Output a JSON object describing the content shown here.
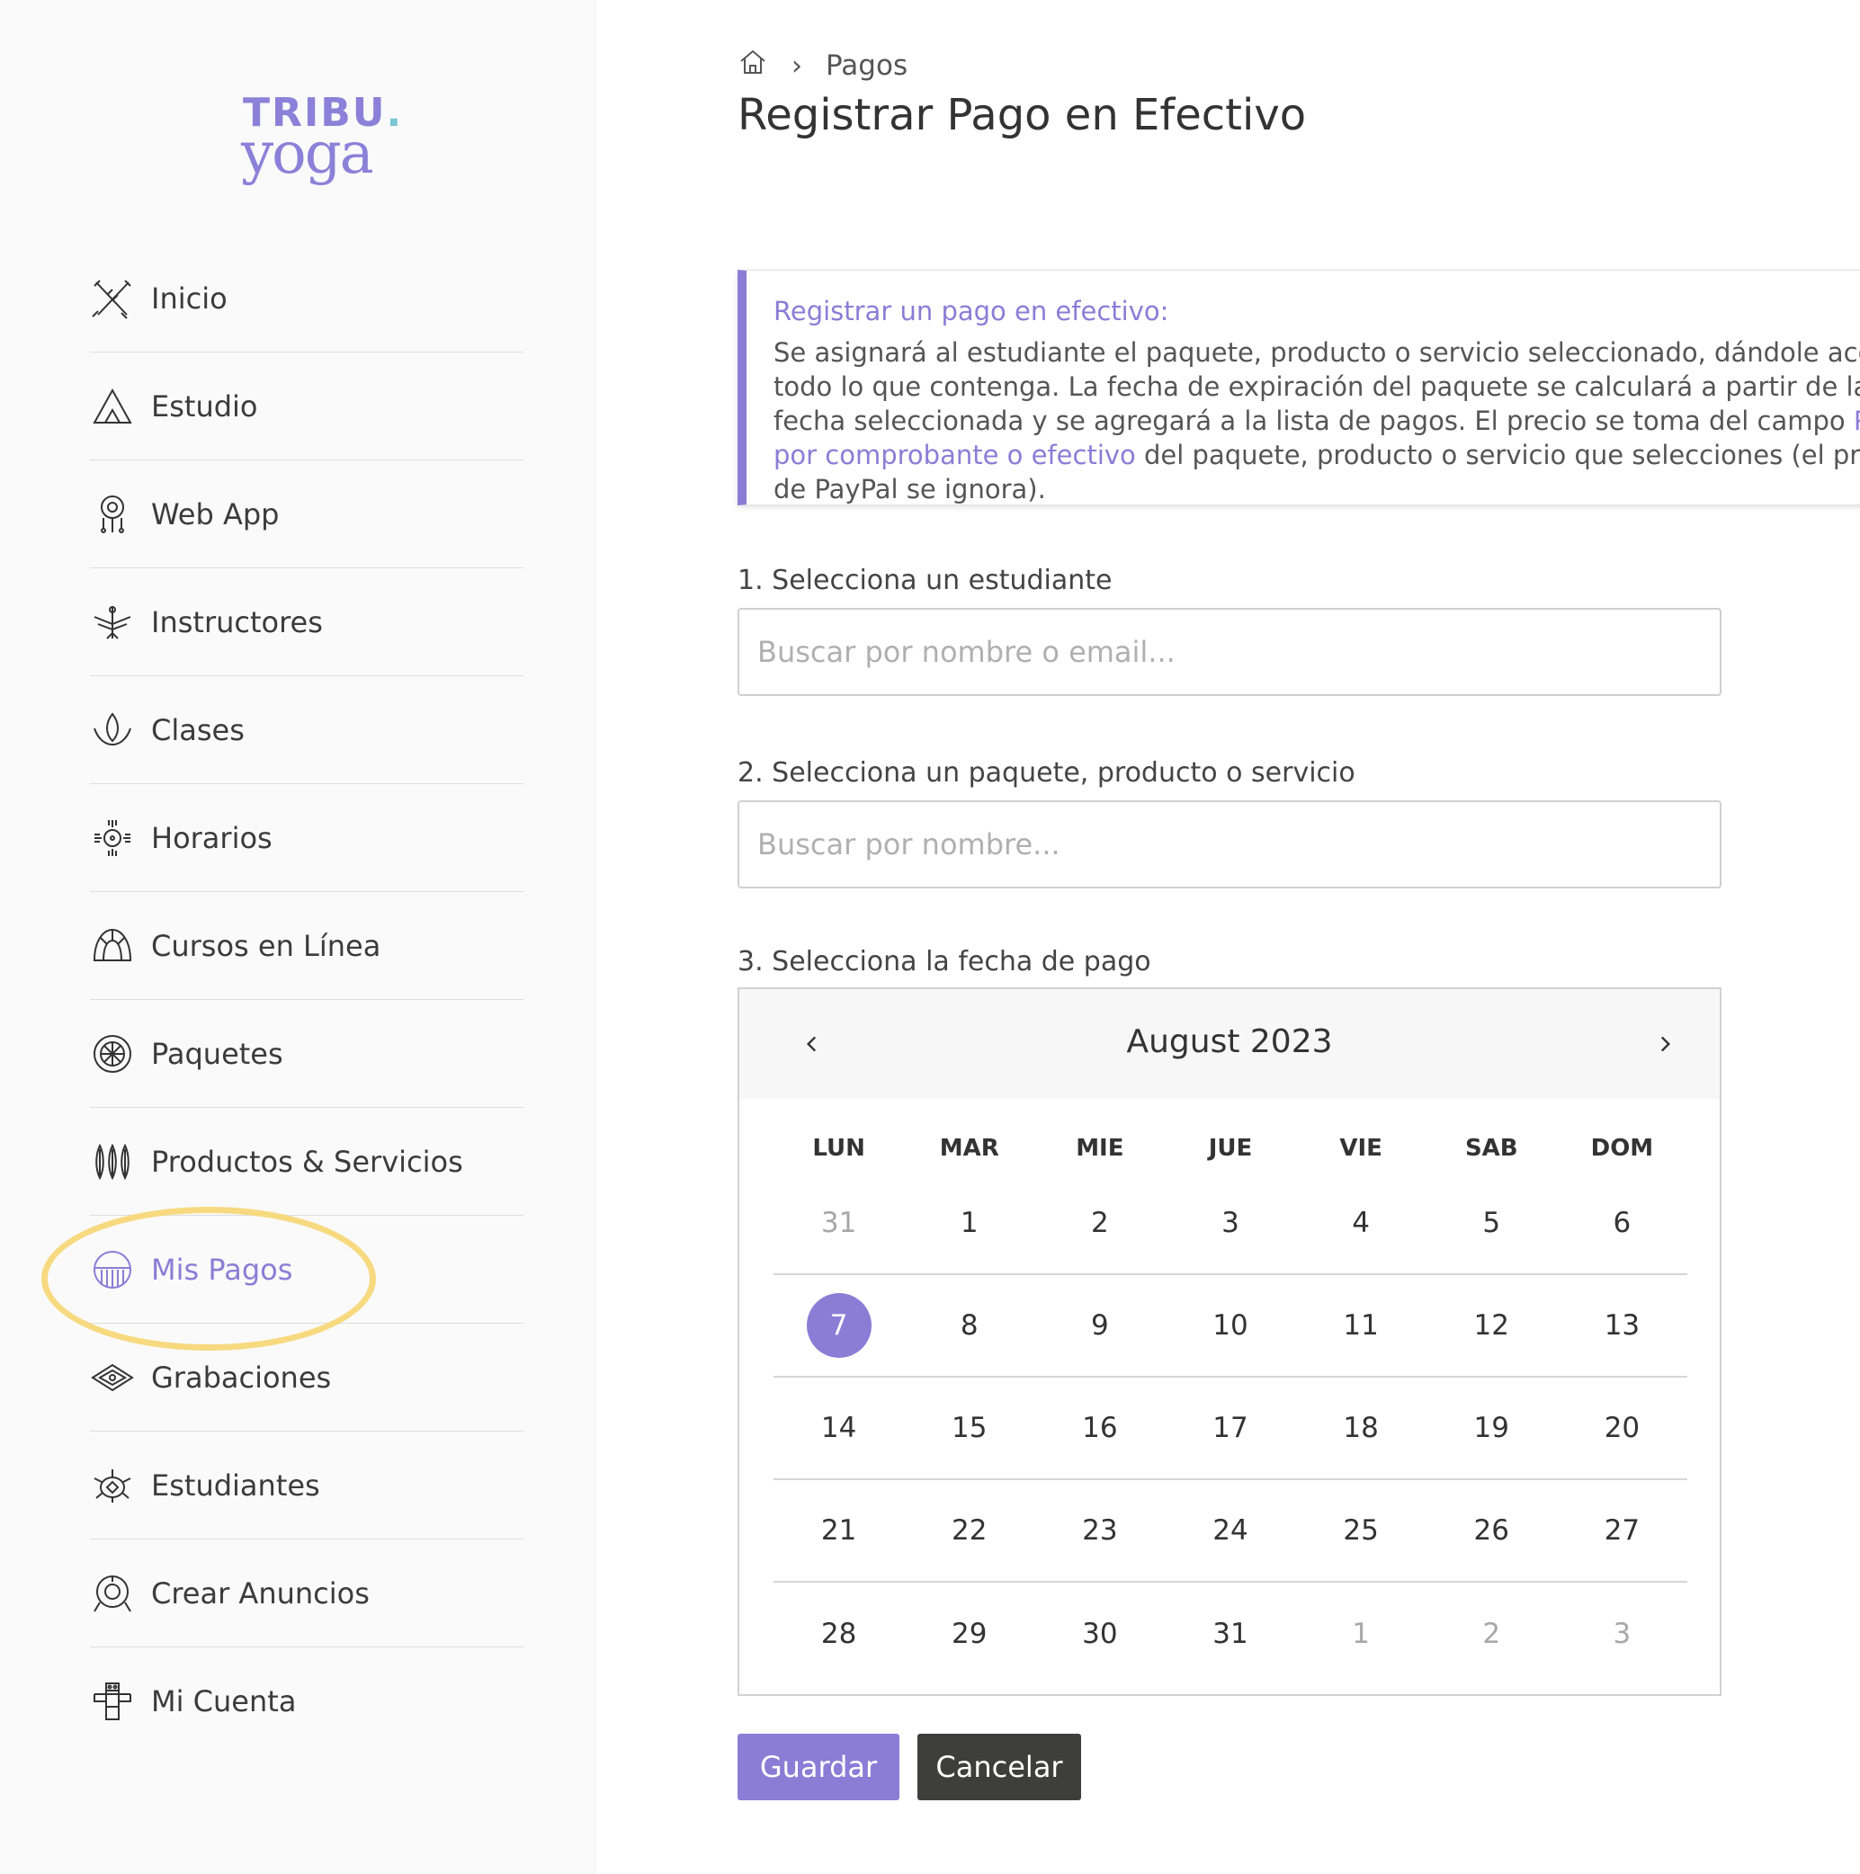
{
  "brand": {
    "line1": "TRIBU",
    "dot": ".",
    "line2": "yoga"
  },
  "sidebar": {
    "items": [
      {
        "label": "Inicio",
        "icon": "arrows-icon"
      },
      {
        "label": "Estudio",
        "icon": "tent-icon"
      },
      {
        "label": "Web App",
        "icon": "dreamcatcher-icon"
      },
      {
        "label": "Instructores",
        "icon": "thunderbird-icon"
      },
      {
        "label": "Clases",
        "icon": "lotus-icon"
      },
      {
        "label": "Horarios",
        "icon": "sun-icon"
      },
      {
        "label": "Cursos en Línea",
        "icon": "headdress-icon"
      },
      {
        "label": "Paquetes",
        "icon": "wheel-icon"
      },
      {
        "label": "Productos & Servicios",
        "icon": "feathers-icon"
      },
      {
        "label": "Mis Pagos",
        "icon": "half-sun-icon",
        "active": true
      },
      {
        "label": "Grabaciones",
        "icon": "diamond-eye-icon"
      },
      {
        "label": "Estudiantes",
        "icon": "turtle-icon"
      },
      {
        "label": "Crear Anuncios",
        "icon": "shield-icon"
      },
      {
        "label": "Mi Cuenta",
        "icon": "totem-icon"
      }
    ]
  },
  "breadcrumb": {
    "home_icon": "home-icon",
    "separator": "›",
    "current": "Pagos"
  },
  "page_title": "Registrar Pago en Efectivo",
  "info": {
    "title": "Registrar un pago en efectivo:",
    "text_part1": "Se asignará al estudiante el paquete, producto o servicio seleccionado, dándole acceso a todo lo que contenga. La fecha de expiración del paquete se calculará a partir de la fecha seleccionada y se agregará a la lista de pagos. El precio se toma del campo ",
    "link": "Precio por comprobante o efectivo",
    "text_part2": " del paquete, producto o servicio que selecciones (el precio de PayPal se ignora)."
  },
  "step1": {
    "label": "1. Selecciona un estudiante",
    "placeholder": "Buscar por nombre o email...",
    "value": ""
  },
  "step2": {
    "label": "2. Selecciona un paquete, producto o servicio",
    "placeholder": "Buscar por nombre...",
    "value": ""
  },
  "step3": {
    "label": "3. Selecciona la fecha de pago"
  },
  "calendar": {
    "month_label": "August 2023",
    "prev": "‹",
    "next": "›",
    "weekdays": [
      "LUN",
      "MAR",
      "MIE",
      "JUE",
      "VIE",
      "SAB",
      "DOM"
    ],
    "weeks": [
      [
        {
          "d": "31",
          "muted": true
        },
        {
          "d": "1"
        },
        {
          "d": "2"
        },
        {
          "d": "3"
        },
        {
          "d": "4"
        },
        {
          "d": "5"
        },
        {
          "d": "6"
        }
      ],
      [
        {
          "d": "7",
          "selected": true
        },
        {
          "d": "8"
        },
        {
          "d": "9"
        },
        {
          "d": "10"
        },
        {
          "d": "11"
        },
        {
          "d": "12"
        },
        {
          "d": "13"
        }
      ],
      [
        {
          "d": "14"
        },
        {
          "d": "15"
        },
        {
          "d": "16"
        },
        {
          "d": "17"
        },
        {
          "d": "18"
        },
        {
          "d": "19"
        },
        {
          "d": "20"
        }
      ],
      [
        {
          "d": "21"
        },
        {
          "d": "22"
        },
        {
          "d": "23"
        },
        {
          "d": "24"
        },
        {
          "d": "25"
        },
        {
          "d": "26"
        },
        {
          "d": "27"
        }
      ],
      [
        {
          "d": "28"
        },
        {
          "d": "29"
        },
        {
          "d": "30"
        },
        {
          "d": "31"
        },
        {
          "d": "1",
          "muted": true
        },
        {
          "d": "2",
          "muted": true
        },
        {
          "d": "3",
          "muted": true
        }
      ]
    ]
  },
  "buttons": {
    "save": "Guardar",
    "cancel": "Cancelar"
  },
  "colors": {
    "accent": "#8b7dd6",
    "highlight": "#f7d980",
    "dark_button": "#3e3e3c"
  }
}
